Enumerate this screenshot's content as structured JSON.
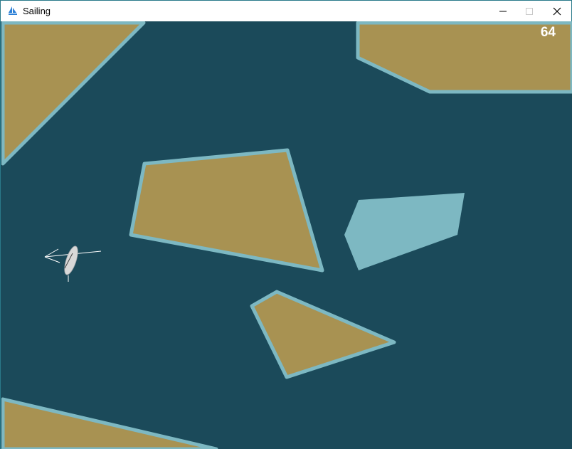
{
  "window": {
    "title": "Sailing",
    "controls": {
      "minimize": "minimize-icon",
      "maximize": "maximize-icon",
      "close": "close-icon"
    }
  },
  "hud": {
    "score": "64"
  },
  "colors": {
    "water": "#1b4a5a",
    "island_fill": "#a89252",
    "island_border": "#7db8c2",
    "shallow": "#7db8c2",
    "boat": "#d8d8d8",
    "wind_arrow": "#ffffff"
  }
}
